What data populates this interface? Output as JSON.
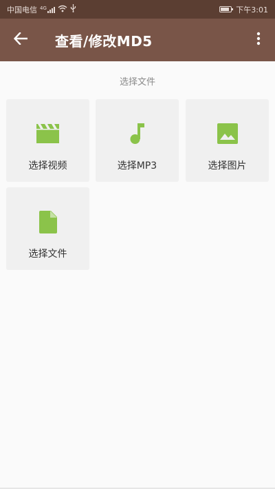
{
  "status_bar": {
    "carrier": "中国电信",
    "signal_label": "4G",
    "time": "下午3:01"
  },
  "app_bar": {
    "title": "查看/修改MD5",
    "back_icon": "arrow-back-icon",
    "menu_icon": "more-vert-icon"
  },
  "section_label": "选择文件",
  "tiles": [
    {
      "label": "选择视频",
      "icon": "movie-icon"
    },
    {
      "label": "选择MP3",
      "icon": "music-note-icon"
    },
    {
      "label": "选择图片",
      "icon": "image-icon"
    },
    {
      "label": "选择文件",
      "icon": "file-icon"
    }
  ],
  "colors": {
    "status_bar": "#5b3e32",
    "app_bar": "#795548",
    "icon_green": "#8bc34a",
    "tile_bg": "#f0f0f0"
  }
}
